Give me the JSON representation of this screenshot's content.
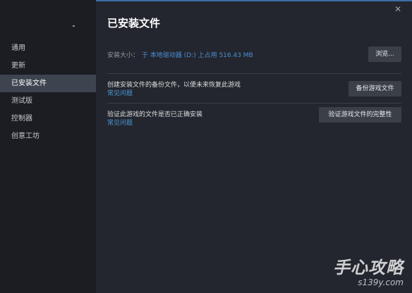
{
  "sidebar": {
    "items": [
      {
        "label": "通用",
        "active": false
      },
      {
        "label": "更新",
        "active": false
      },
      {
        "label": "已安装文件",
        "active": true
      },
      {
        "label": "测试版",
        "active": false
      },
      {
        "label": "控制器",
        "active": false
      },
      {
        "label": "创意工坊",
        "active": false
      }
    ]
  },
  "main": {
    "title": "已安装文件",
    "close_icon": "close-icon",
    "install_size": {
      "label": "安装大小：",
      "value": "于 本地驱动器 (D:) 上占用 516.43 MB",
      "button_label": "浏览..."
    },
    "backup": {
      "text": "创建安装文件的备份文件，以便未来恢复此游戏",
      "link": "常见问题",
      "button_label": "备份游戏文件"
    },
    "verify": {
      "text": "验证此游戏的文件是否已正确安装",
      "link": "常见问题",
      "button_label": "验证游戏文件的完整性"
    }
  },
  "watermark": {
    "main": "手心攻略",
    "sub": "s139y.com"
  },
  "colors": {
    "background": "#23262e",
    "sidebar": "#1b1d23",
    "active_item": "#3d4450",
    "link": "#4b9ad6",
    "button": "#3a3f48"
  }
}
